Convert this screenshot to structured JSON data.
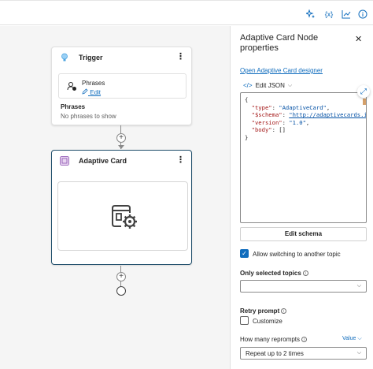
{
  "toolbar": {
    "icons": [
      "sparkle-icon",
      "variables-icon",
      "analytics-icon",
      "info-icon"
    ],
    "variables_glyph": "{x}"
  },
  "canvas": {
    "trigger_node": {
      "title": "Trigger",
      "phrases_box_label": "Phrases",
      "edit_label": "Edit",
      "phrases_heading": "Phrases",
      "phrases_empty": "No phrases to show"
    },
    "card_node": {
      "title": "Adaptive Card"
    }
  },
  "panel": {
    "title": "Adaptive Card Node properties",
    "designer_link": "Open Adaptive Card designer",
    "edit_json_label": "Edit JSON",
    "json_lines": {
      "open": "{",
      "type_key": "\"type\"",
      "type_val": "\"AdaptiveCard\"",
      "schema_key": "\"$schema\"",
      "schema_val": "\"http://adaptivecards.io",
      "version_key": "\"version\"",
      "version_val": "\"1.0\"",
      "body_key": "\"body\"",
      "body_val": "[]",
      "close": "}"
    },
    "edit_schema_button": "Edit schema",
    "allow_switching": {
      "label": "Allow switching to another topic",
      "checked": true
    },
    "only_selected_topics": {
      "label": "Only selected topics",
      "value": ""
    },
    "retry_prompt": {
      "label": "Retry prompt",
      "customize_label": "Customize",
      "checked": false
    },
    "reprompts": {
      "label": "How many reprompts",
      "value_tag": "Value",
      "selected": "Repeat up to 2 times"
    }
  },
  "colors": {
    "accent": "#0f6cbd",
    "canvas_bg": "#f5f5f5",
    "selected_border": "#1f4e6b"
  }
}
